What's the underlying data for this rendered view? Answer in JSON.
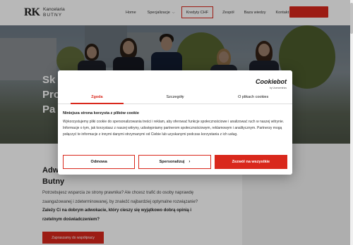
{
  "header": {
    "logo": {
      "mark": "RK",
      "line1": "Kancelaria",
      "line2": "BUTNY"
    },
    "nav": [
      {
        "label": "Home"
      },
      {
        "label": "Specjalizacje",
        "dropdown": true
      },
      {
        "label": "Kredyty CHF"
      },
      {
        "label": "Zespół"
      },
      {
        "label": "Baza wiedzy"
      },
      {
        "label": "Kontakt"
      }
    ],
    "cta_color": "#d9281c"
  },
  "hero": {
    "title_lines": [
      "Sk",
      "Pro",
      "Pa"
    ]
  },
  "content": {
    "title_line1": "Adw",
    "title_line2": "Butny",
    "text_plain": "Potrzebujesz wsparcia ze strony prawnika? Ale chcesz trafić do osoby naprawdę zaangażowanej i zdeterminowanej, by znaleźć najbardziej optymalne rozwiązanie?",
    "text_bold": "Zależy Ci na dobrym adwokacie, który cieszy się wyjątkowo dobrą opinią i rzetelnym doświadczeniem?",
    "cta": "Zapraszamy do współpracy"
  },
  "cookie_dialog": {
    "brand": "Cookiebot",
    "brand_sub": "by Usercentrics",
    "tabs": [
      "Zgoda",
      "Szczegóły",
      "O plikach cookies"
    ],
    "active_tab": 0,
    "title": "Niniejsza strona korzysta z plików cookie",
    "body": "Wykorzystujemy pliki cookie do spersonalizowania treści i reklam, aby oferować funkcje społecznościowe i analizować ruch w naszej witrynie. Informacje o tym, jak korzystasz z naszej witryny, udostępniamy partnerom społecznościowym, reklamowym i analitycznym. Partnerzy mogą połączyć te informacje z innymi danymi otrzymanymi od Ciebie lub uzyskanymi podczas korzystania z ich usług.",
    "buttons": {
      "deny": "Odmowa",
      "customize": "Spersonalizuj",
      "allow_all": "Zezwól na wszystkie"
    },
    "accent_color": "#d9281c"
  }
}
